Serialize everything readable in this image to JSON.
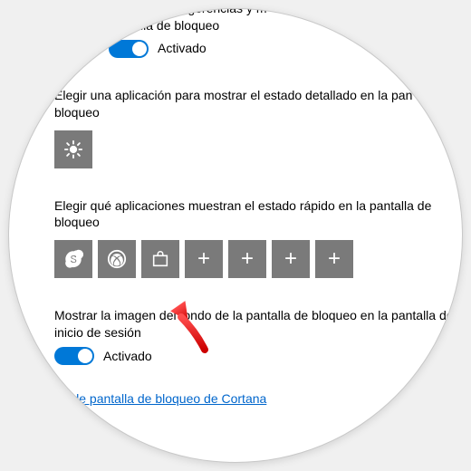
{
  "top": {
    "fragment1": "os, sugerencias y m",
    "fragment2": "pantalla de bloqueo",
    "toggle_label": "Activado"
  },
  "detailed": {
    "heading": "Elegir una aplicación para mostrar el estado detallado en la pan de bloqueo",
    "app_icon": "weather-icon"
  },
  "quick": {
    "heading": "Elegir qué aplicaciones muestran el estado rápido en la pantalla de bloqueo",
    "slots": [
      {
        "icon": "skype-icon"
      },
      {
        "icon": "xbox-icon"
      },
      {
        "icon": "store-icon"
      },
      {
        "icon": "plus-icon"
      },
      {
        "icon": "plus-icon"
      },
      {
        "icon": "plus-icon"
      },
      {
        "icon": "plus-icon"
      }
    ]
  },
  "signin_bg": {
    "heading": "Mostrar la imagen del fondo de la pantalla de bloqueo en la pantalla de inicio de sesión",
    "toggle_label": "Activado"
  },
  "link": {
    "text": "ón de pantalla de bloqueo de Cortana"
  }
}
